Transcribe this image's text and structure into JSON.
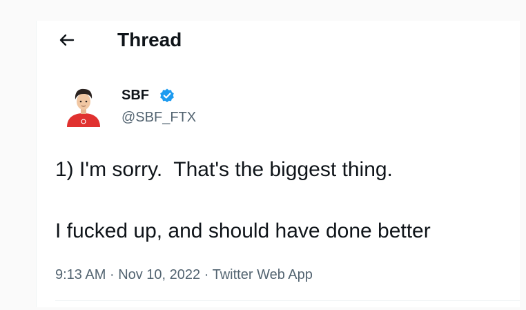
{
  "header": {
    "title": "Thread",
    "back_icon": "arrow-left-icon"
  },
  "author": {
    "display_name": "SBF",
    "handle": "@SBF_FTX",
    "verified": true,
    "verified_icon": "verified-badge-icon",
    "avatar_icon": "avatar-icon"
  },
  "tweet": {
    "lines": [
      "1) I'm sorry.  That's the biggest thing.",
      "I fucked up, and should have done better"
    ],
    "time": "9:13 AM",
    "separator": "·",
    "date": "Nov 10, 2022",
    "source": "Twitter Web App"
  },
  "colors": {
    "text": "#0f1419",
    "secondary": "#536471",
    "verified": "#1d9bf0",
    "avatar_shirt": "#e0312f"
  }
}
